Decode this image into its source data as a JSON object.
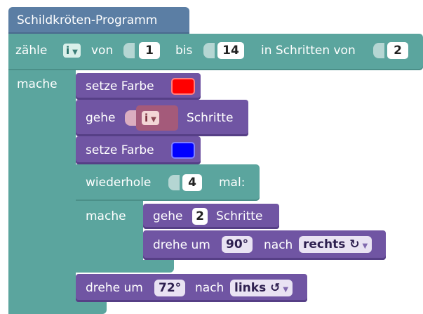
{
  "program": {
    "title": "Schildkröten-Programm"
  },
  "loop": {
    "count_label": "zähle",
    "var": "i",
    "from_label": "von",
    "from_value": "1",
    "to_label": "bis",
    "to_value": "14",
    "step_label": "in Schritten von",
    "step_value": "2",
    "do_label": "mache"
  },
  "body": {
    "set_color_1_label": "setze Farbe",
    "set_color_1_value": "#ff0000",
    "go_label": "gehe",
    "go_var": "i",
    "go_unit": "Schritte",
    "set_color_2_label": "setze Farbe",
    "set_color_2_value": "#0000ff",
    "repeat_label": "wiederhole",
    "repeat_value": "4",
    "repeat_suffix": "mal:",
    "repeat_do_label": "mache",
    "inner_go_label": "gehe",
    "inner_go_value": "2",
    "inner_go_unit": "Schritte",
    "inner_turn_label": "drehe um",
    "inner_turn_value": "90°",
    "inner_turn_dir_label": "nach",
    "inner_turn_dir": "rechts ↻",
    "outer_turn_label": "drehe um",
    "outer_turn_value": "72°",
    "outer_turn_dir_label": "nach",
    "outer_turn_dir": "links ↺"
  },
  "colors": {
    "hat": "#5b7ea4",
    "loop": "#5ba59e",
    "statement": "#7055a3",
    "value": "#ffffff"
  },
  "icons": {
    "dropdown": "chevron-down-icon"
  }
}
